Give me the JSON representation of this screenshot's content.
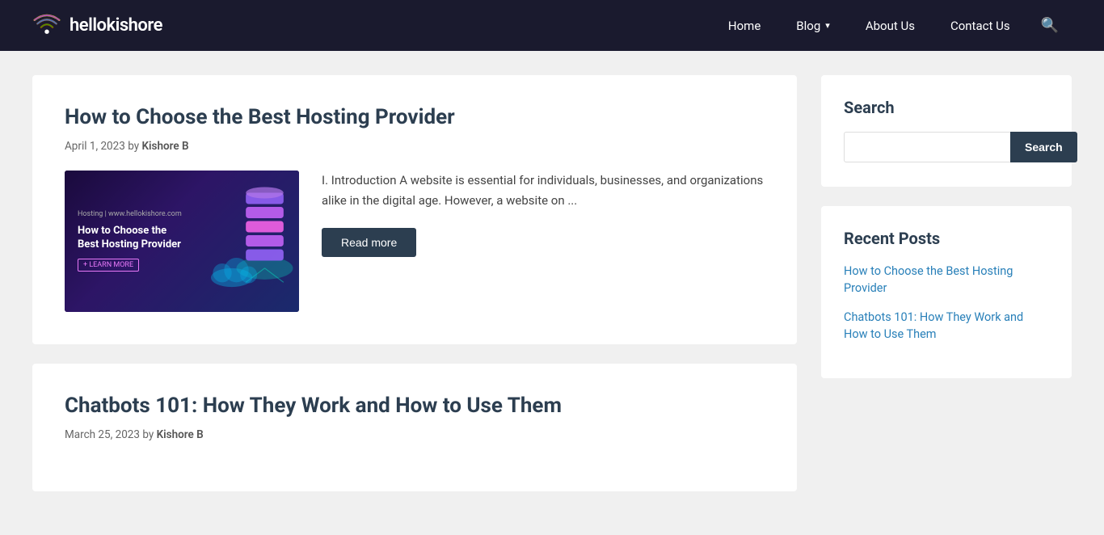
{
  "site": {
    "name": "hellokishore",
    "logo_alt": "hellokishore logo"
  },
  "nav": {
    "home_label": "Home",
    "blog_label": "Blog",
    "about_label": "About Us",
    "contact_label": "Contact Us"
  },
  "articles": [
    {
      "title": "How to Choose the Best Hosting Provider",
      "date": "April 1, 2023",
      "author": "Kishore B",
      "excerpt": "I. Introduction A website is essential for individuals, businesses, and organizations alike in the digital age. However, a website on ...",
      "read_more": "Read more",
      "image_site_label": "Hosting | www.hellokishore.com",
      "image_title": "How to Choose the Best Hosting Provider",
      "image_learn_more": "+ LEARN MORE"
    },
    {
      "title": "Chatbots 101: How They Work and How to Use Them",
      "date": "March 25, 2023",
      "author": "Kishore B",
      "excerpt": "",
      "read_more": ""
    }
  ],
  "sidebar": {
    "search_widget_title": "Search",
    "search_placeholder": "",
    "search_button_label": "Search",
    "recent_posts_title": "Recent Posts",
    "recent_posts": [
      {
        "title": "How to Choose the Best Hosting Provider",
        "url": "#"
      },
      {
        "title": "Chatbots 101: How They Work and How to Use Them",
        "url": "#"
      }
    ]
  }
}
